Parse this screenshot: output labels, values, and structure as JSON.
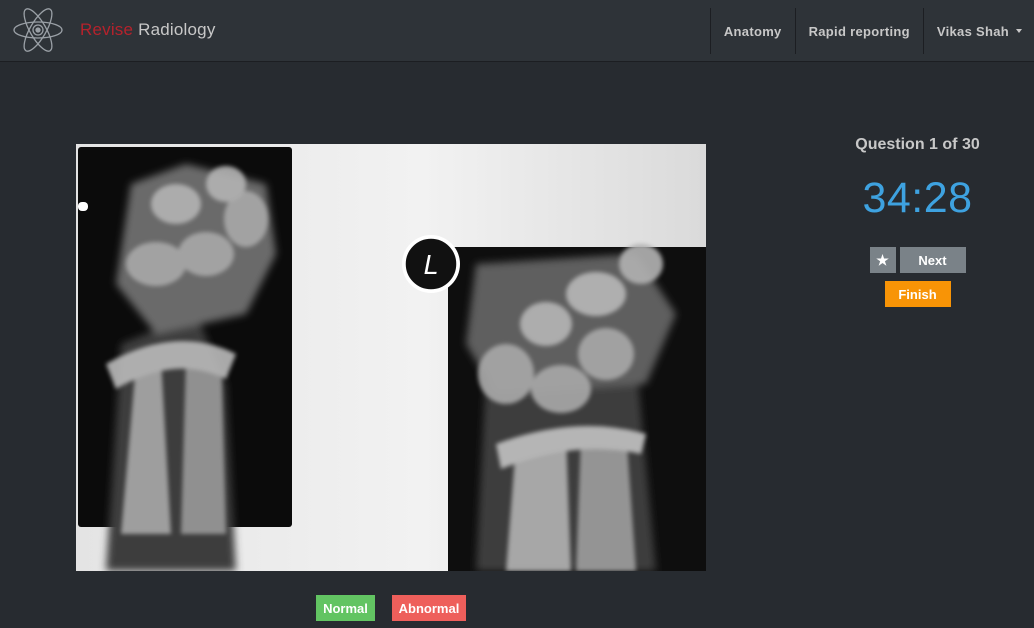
{
  "app": {
    "brand_part1": "Revise",
    "brand_part2": "Radiology",
    "logo_icon": "atom-icon"
  },
  "nav": {
    "items": [
      {
        "label": "Anatomy"
      },
      {
        "label": "Rapid reporting"
      }
    ],
    "user": {
      "label": "Vikas Shah",
      "icon": "chevron-down-icon"
    }
  },
  "quiz": {
    "question_counter": "Question 1 of 30",
    "timer": "34:28",
    "star_label": "★",
    "next_label": "Next",
    "finish_label": "Finish",
    "normal_label": "Normal",
    "abnormal_label": "Abnormal",
    "image_marker": "L"
  },
  "colors": {
    "background": "#272b30",
    "navbar": "#2e3338",
    "brand_accent": "#b5222c",
    "timer": "#3ea2e0",
    "finish": "#f89406",
    "normal": "#62c462",
    "abnormal": "#ee5f5b",
    "neutral_button": "#7a8288"
  }
}
